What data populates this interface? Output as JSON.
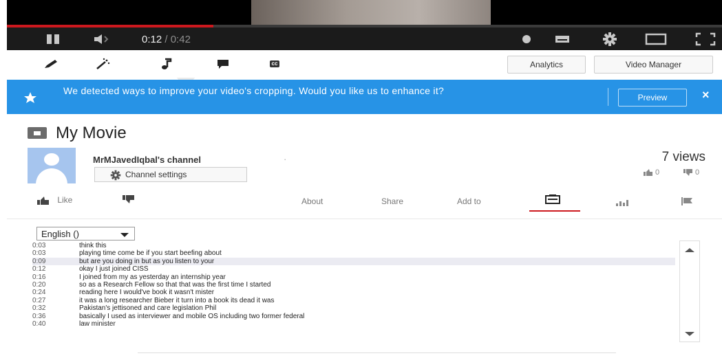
{
  "player": {
    "time_current": "0:12",
    "time_sep": " / ",
    "time_total": "0:42",
    "progress_fraction": 0.286,
    "icons": [
      "pause-icon",
      "volume-icon",
      "watch-later-icon",
      "subtitles-icon",
      "settings-gear-icon",
      "theater-mode-icon",
      "fullscreen-icon"
    ]
  },
  "editor_tools": {
    "icons": [
      "enhancements-pencil-icon",
      "effects-wand-icon",
      "audio-note-icon",
      "annotations-icon",
      "subtitles-cc-icon"
    ],
    "cc_label": "cc",
    "analytics_label": "Analytics",
    "video_manager_label": "Video Manager"
  },
  "banner": {
    "text": "We detected ways to improve your video's cropping. Would you like us to enhance it?",
    "preview_label": "Preview",
    "close_label": "×"
  },
  "video": {
    "title": "My Movie",
    "channel_name": "MrMJavedIqbal's channel",
    "channel_sep": "·",
    "channel_settings_label": "Channel settings",
    "views": "7 views",
    "likes": "0",
    "dislikes": "0"
  },
  "actions": {
    "like_label": "Like",
    "about_label": "About",
    "share_label": "Share",
    "add_to_label": "Add to"
  },
  "transcript": {
    "language": "English ()",
    "highlighted_index": 2,
    "rows": [
      {
        "time": "0:03",
        "text": "think this"
      },
      {
        "time": "0:03",
        "text": "playing time come be if you start beefing about"
      },
      {
        "time": "0:09",
        "text": "but are you doing in but as you listen to your"
      },
      {
        "time": "0:12",
        "text": "okay I just joined CISS"
      },
      {
        "time": "0:16",
        "text": "I joined from my as yesterday an internship year"
      },
      {
        "time": "0:20",
        "text": "so as a Research Fellow so that that was the first time I started"
      },
      {
        "time": "0:24",
        "text": "reading here I would've book it wasn't mister"
      },
      {
        "time": "0:27",
        "text": "it was a long researcher Bieber it turn into a book its dead it was"
      },
      {
        "time": "0:32",
        "text": "Pakistan's jettisoned and care legislation Phil"
      },
      {
        "time": "0:36",
        "text": "basically I used as interviewer and mobile OS including two former federal"
      },
      {
        "time": "0:40",
        "text": "law minister"
      }
    ]
  },
  "colors": {
    "banner_blue": "#2793e6",
    "progress_red": "#cc181e",
    "control_bar": "#1b1b1b"
  }
}
